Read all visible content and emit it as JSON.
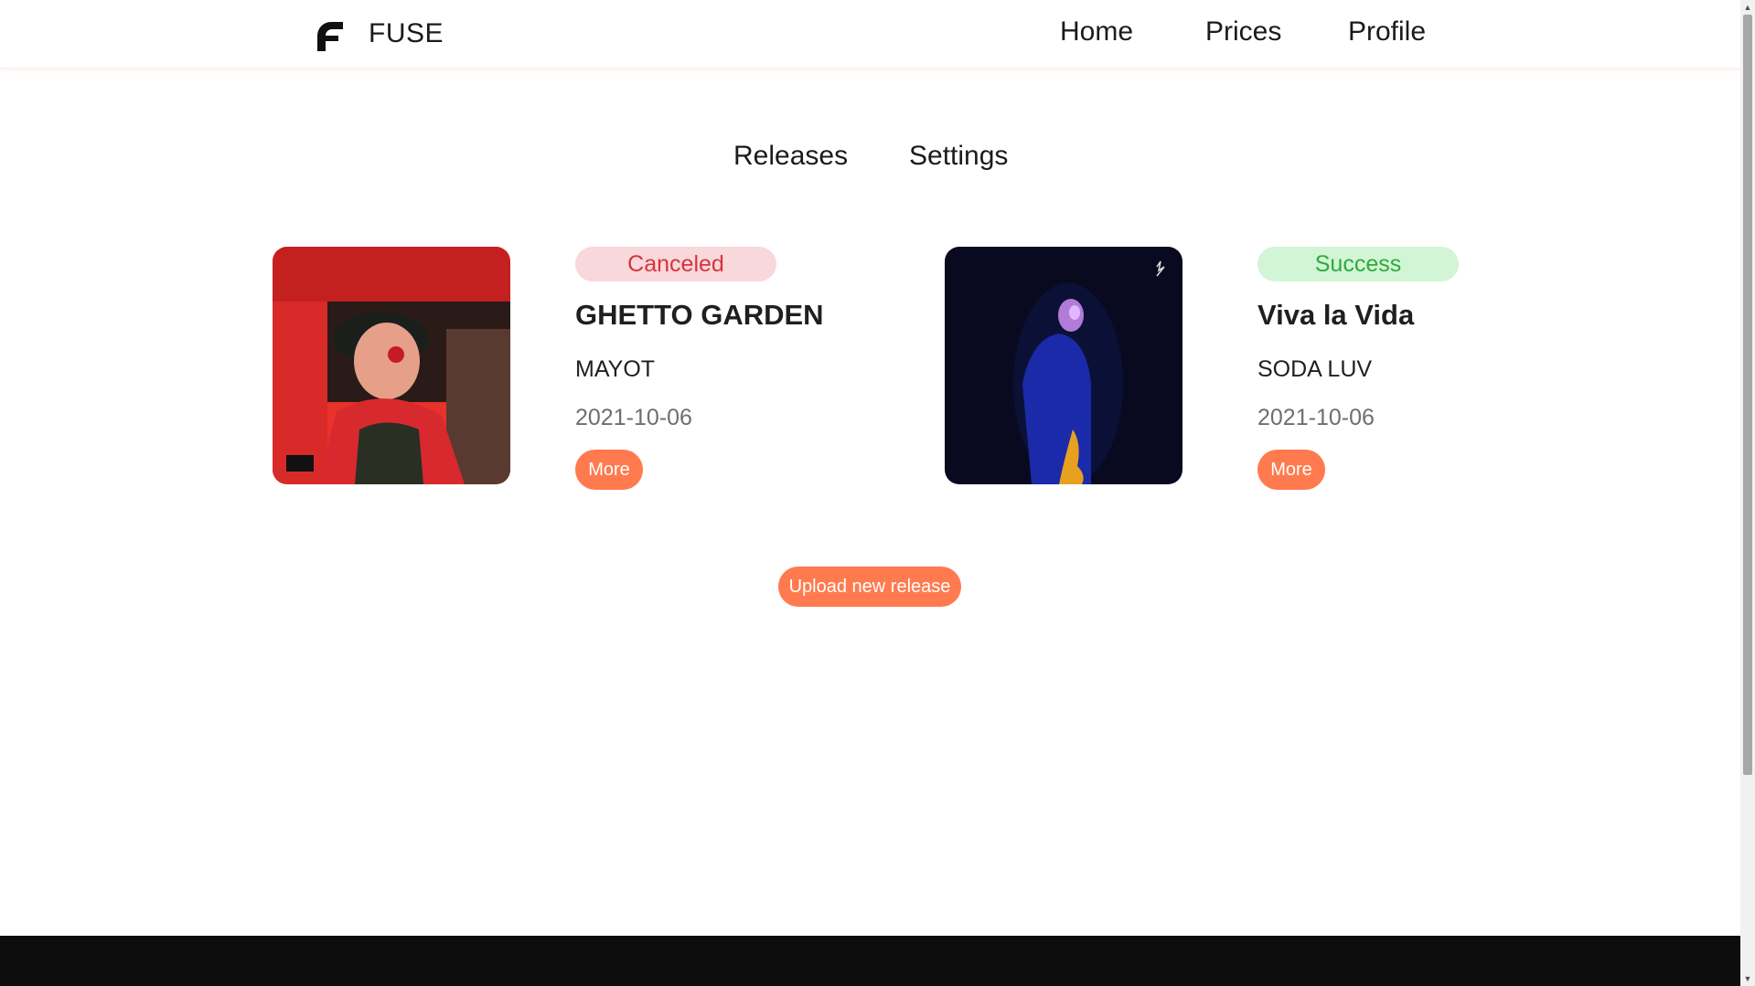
{
  "header": {
    "brand": "FUSE",
    "nav": [
      {
        "label": "Home"
      },
      {
        "label": "Prices"
      },
      {
        "label": "Profile"
      }
    ]
  },
  "subnav": {
    "tabs": [
      {
        "label": "Releases"
      },
      {
        "label": "Settings"
      }
    ]
  },
  "releases": [
    {
      "status": "Canceled",
      "title": "GHETTO GARDEN",
      "artist": "MAYOT",
      "date": "2021-10-06",
      "more_label": "More",
      "cover_icon": "album-cover-image"
    },
    {
      "status": "Success",
      "title": "Viva la Vida",
      "artist": "SODA LUV",
      "date": "2021-10-06",
      "more_label": "More",
      "cover_icon": "album-cover-image"
    }
  ],
  "upload_label": "Upload new release",
  "colors": {
    "accent": "#ff7a4e",
    "canceled_bg": "#f8d8da",
    "canceled_text": "#d8333f",
    "success_bg": "#d2f5d5",
    "success_text": "#2faa3d",
    "footer": "#0d0d0d"
  }
}
